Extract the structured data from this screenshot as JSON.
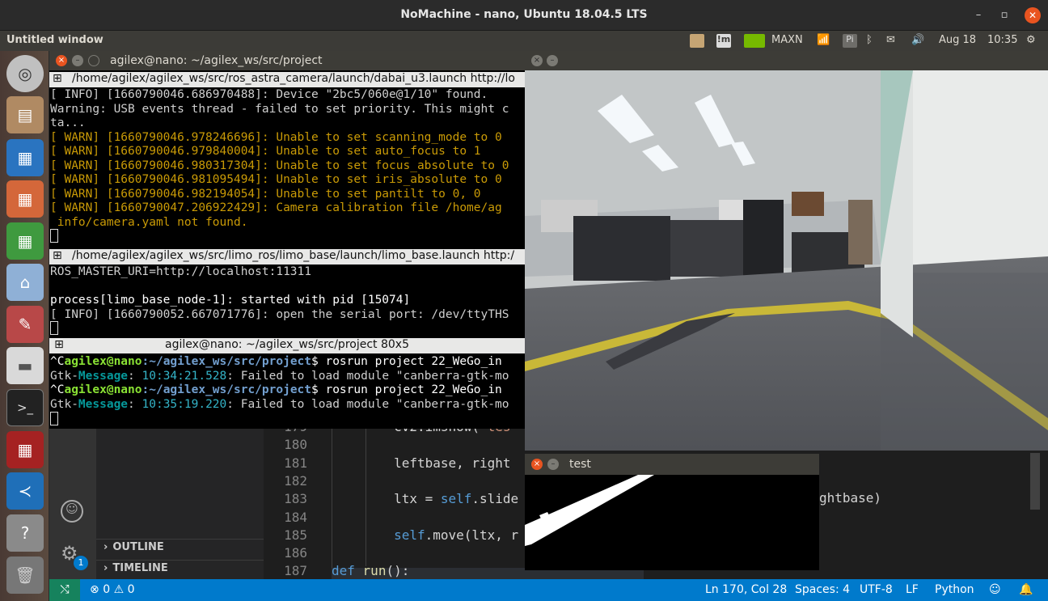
{
  "nomachine": {
    "title": "NoMachine - nano, Ubuntu 18.04.5 LTS"
  },
  "panel": {
    "window_title": "Untitled window",
    "power_mode": "MAXN",
    "date": "Aug 18",
    "time": "10:35",
    "pi_label": "Pi"
  },
  "terminal": {
    "title": "agilex@nano: ~/agilex_ws/src/project",
    "pane1": {
      "header": "/home/agilex/agilex_ws/src/ros_astra_camera/launch/dabai_u3.launch http://lo",
      "lines": [
        "[ INFO] [1660790046.686970488]: Device \"2bc5/060e@1/10\" found.",
        "Warning: USB events thread - failed to set priority. This might c",
        "ta...",
        "[ WARN] [1660790046.978246696]: Unable to set scanning_mode to 0",
        "[ WARN] [1660790046.979840004]: Unable to set auto_focus to 1",
        "[ WARN] [1660790046.980317304]: Unable to set focus_absolute to 0",
        "[ WARN] [1660790046.981095494]: Unable to set iris_absolute to 0",
        "[ WARN] [1660790046.982194054]: Unable to set pantilt to 0, 0",
        "[ WARN] [1660790047.206922429]: Camera calibration file /home/ag",
        " info/camera.yaml not found."
      ]
    },
    "pane2": {
      "header": "/home/agilex/agilex_ws/src/limo_ros/limo_base/launch/limo_base.launch http:/",
      "lines": [
        "ROS_MASTER_URI=http://localhost:11311",
        "",
        "process[limo_base_node-1]: started with pid [15074]",
        "[ INFO] [1660790052.667071776]: open the serial port: /dev/ttyTHS"
      ]
    },
    "pane3": {
      "header": "agilex@nano: ~/agilex_ws/src/project 80x5",
      "prompt_prefix": "^C",
      "user_host": "agilex@nano",
      "path": ":~/agilex_ws/src/project",
      "cmd1": "$ rosrun project 22_WeGo_in",
      "gtk_label": "Gtk-",
      "msg_label": "Message",
      "ts1": "10:34:21.528",
      "gtk_rest": ": Failed to load module \"canberra-gtk-mo",
      "cmd2": "$ rosrun project 22_WeGo_in",
      "ts2": "10:35:19.220"
    }
  },
  "vscode": {
    "outline_label": "OUTLINE",
    "timeline_label": "TIMELINE",
    "settings_badge": "1",
    "code_lines": [
      {
        "num": "179",
        "parts": [
          [
            "",
            "        "
          ],
          [
            "",
            "cv2.imshow("
          ],
          [
            "str",
            "'tes"
          ]
        ]
      },
      {
        "num": "180",
        "parts": []
      },
      {
        "num": "181",
        "parts": [
          [
            "",
            "        leftbase, right"
          ]
        ]
      },
      {
        "num": "182",
        "parts": []
      },
      {
        "num": "183",
        "parts": [
          [
            "",
            "        ltx = "
          ],
          [
            "kw",
            "self"
          ],
          [
            "",
            ".slide"
          ]
        ]
      },
      {
        "num": "184",
        "parts": []
      },
      {
        "num": "185",
        "parts": [
          [
            "",
            "        "
          ],
          [
            "kw",
            "self"
          ],
          [
            "",
            ".move(ltx, r"
          ]
        ]
      },
      {
        "num": "186",
        "parts": []
      },
      {
        "num": "187",
        "parts": [
          [
            "kw",
            "def"
          ],
          [
            "",
            " "
          ],
          [
            "fn",
            "run"
          ],
          [
            "",
            "():"
          ]
        ]
      }
    ],
    "right_code_fragment": "ghtbase)",
    "status": {
      "errors": "0",
      "warnings": "0",
      "cursor": "Ln 170, Col 28",
      "spaces": "Spaces: 4",
      "encoding": "UTF-8",
      "eol": "LF",
      "language": "Python"
    }
  },
  "test_window": {
    "title": "test"
  },
  "colors": {
    "ubuntu_orange": "#e95420",
    "vscode_blue": "#007acc",
    "warn_yellow": "#c99a06"
  }
}
